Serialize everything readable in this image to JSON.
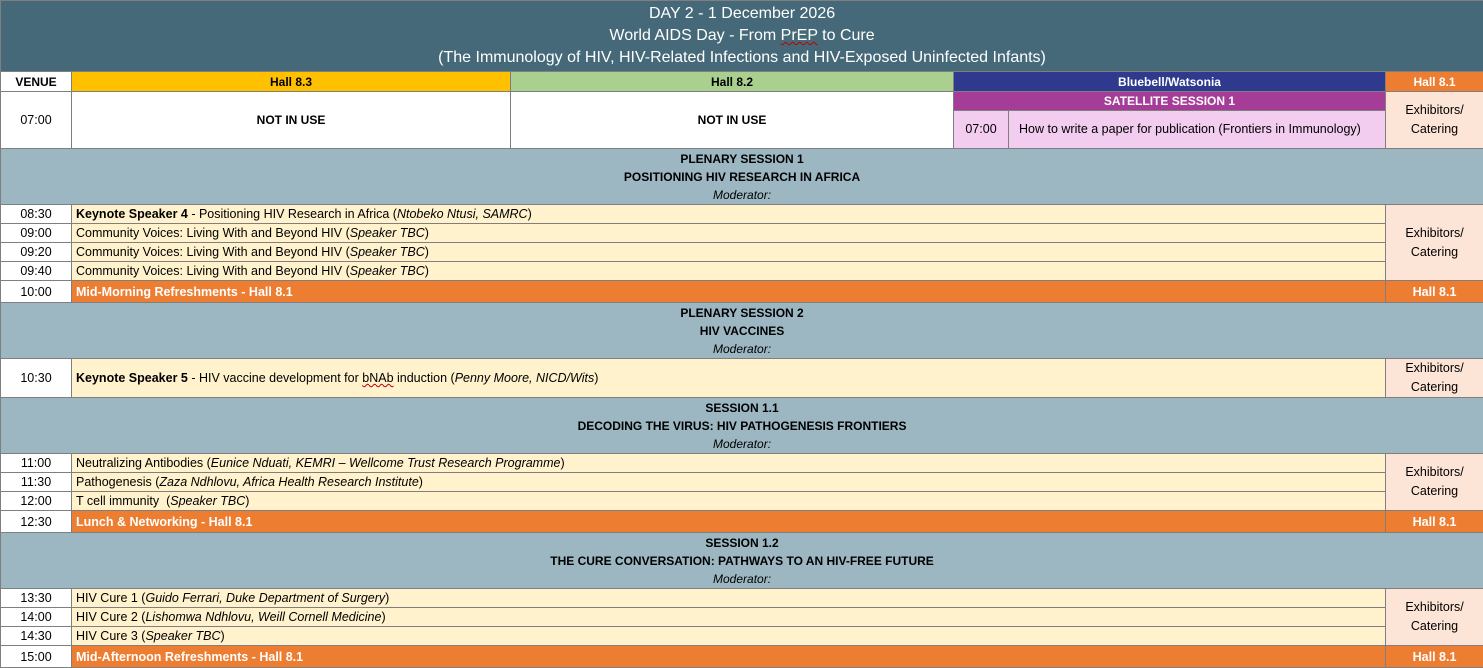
{
  "header": {
    "line1": "DAY 2 - 1 December 2026",
    "line2_pre": "World AIDS Day - From ",
    "line2_prep": "PrEP",
    "line2_post": " to Cure",
    "line3": "(The Immunology of HIV, HIV-Related Infections and HIV-Exposed Uninfected Infants)"
  },
  "venues": {
    "label": "VENUE",
    "hall83": "Hall 8.3",
    "hall82": "Hall 8.2",
    "bluebell": "Bluebell/Watsonia",
    "hall81": "Hall 8.1"
  },
  "row0700": {
    "time": "07:00",
    "hall83": "NOT IN USE",
    "hall82": "NOT IN USE",
    "satellite_title": "SATELLITE SESSION 1",
    "sat_time": "07:00",
    "sat_text": "How to write a paper for publication (Frontiers in Immunology)",
    "exhibitors": "Exhibitors/ Catering"
  },
  "colors": {
    "header": "#456978",
    "hall83": "#ffc000",
    "hall82": "#a9d08e",
    "bluebell": "#2f3a8f",
    "hall81": "#ed7d31",
    "satellite": "#a43c98",
    "plenary": "#9cb7c2",
    "talk": "#fff2cc",
    "exhibitors": "#fce4d6"
  },
  "plenary1": {
    "title": "PLENARY SESSION 1",
    "subtitle": "POSITIONING HIV RESEARCH IN AFRICA",
    "moderator": "Moderator:",
    "talks": [
      {
        "time": "08:30",
        "bold": "Keynote Speaker 4",
        "text": " - Positioning HIV Research in Africa (",
        "ital": "Ntobeko Ntusi, SAMRC",
        "end": ")"
      },
      {
        "time": "09:00",
        "bold": "",
        "text": "Community Voices: Living With and Beyond HIV (",
        "ital": "Speaker TBC",
        "end": ")"
      },
      {
        "time": "09:20",
        "bold": "",
        "text": "Community Voices: Living With and Beyond HIV (",
        "ital": "Speaker TBC",
        "end": ")"
      },
      {
        "time": "09:40",
        "bold": "",
        "text": "Community Voices: Living With and Beyond HIV (",
        "ital": "Speaker TBC",
        "end": ")"
      }
    ],
    "exhibitors": "Exhibitors/ Catering",
    "break_time": "10:00",
    "break_text": "Mid-Morning Refreshments - Hall 8.1",
    "break_hall": "Hall 8.1"
  },
  "plenary2": {
    "title": "PLENARY SESSION 2",
    "subtitle": "HIV VACCINES",
    "moderator": "Moderator:",
    "time": "10:30",
    "bold": "Keynote Speaker 5",
    "text_pre": " - HIV vaccine development for ",
    "bnab": "bNAb",
    "text_post": " induction (",
    "ital": "Penny Moore, NICD/Wits",
    "end": ")",
    "exhibitors": "Exhibitors/ Catering"
  },
  "session11": {
    "title": "SESSION 1.1",
    "subtitle": "DECODING THE VIRUS: HIV PATHOGENESIS FRONTIERS",
    "moderator": "Moderator:",
    "talks": [
      {
        "time": "11:00",
        "text": "Neutralizing Antibodies (",
        "ital": "Eunice Nduati, KEMRI – Wellcome Trust Research Programme",
        "end": ")"
      },
      {
        "time": "11:30",
        "text": "Pathogenesis (",
        "ital": "Zaza Ndhlovu, Africa Health Research Institute",
        "end": ")"
      },
      {
        "time": "12:00",
        "text": "T cell immunity  (",
        "ital": "Speaker TBC",
        "end": ")"
      }
    ],
    "exhibitors": "Exhibitors/ Catering",
    "break_time": "12:30",
    "break_text": "Lunch & Networking - Hall 8.1",
    "break_hall": "Hall 8.1"
  },
  "session12": {
    "title": "SESSION 1.2",
    "subtitle": "THE CURE CONVERSATION: PATHWAYS TO AN HIV-FREE FUTURE",
    "moderator": "Moderator:",
    "talks": [
      {
        "time": "13:30",
        "text": "HIV Cure 1 (",
        "ital": "Guido Ferrari, Duke Department of Surgery",
        "end": ")"
      },
      {
        "time": "14:00",
        "text": "HIV Cure 2 (",
        "ital": "Lishomwa Ndhlovu, Weill Cornell Medicine",
        "end": ")"
      },
      {
        "time": "14:30",
        "text": "HIV Cure 3 (",
        "ital": "Speaker TBC",
        "end": ")"
      }
    ],
    "exhibitors": "Exhibitors/ Catering",
    "break_time": "15:00",
    "break_text": "Mid-Afternoon Refreshments - Hall 8.1",
    "break_hall": "Hall 8.1"
  }
}
